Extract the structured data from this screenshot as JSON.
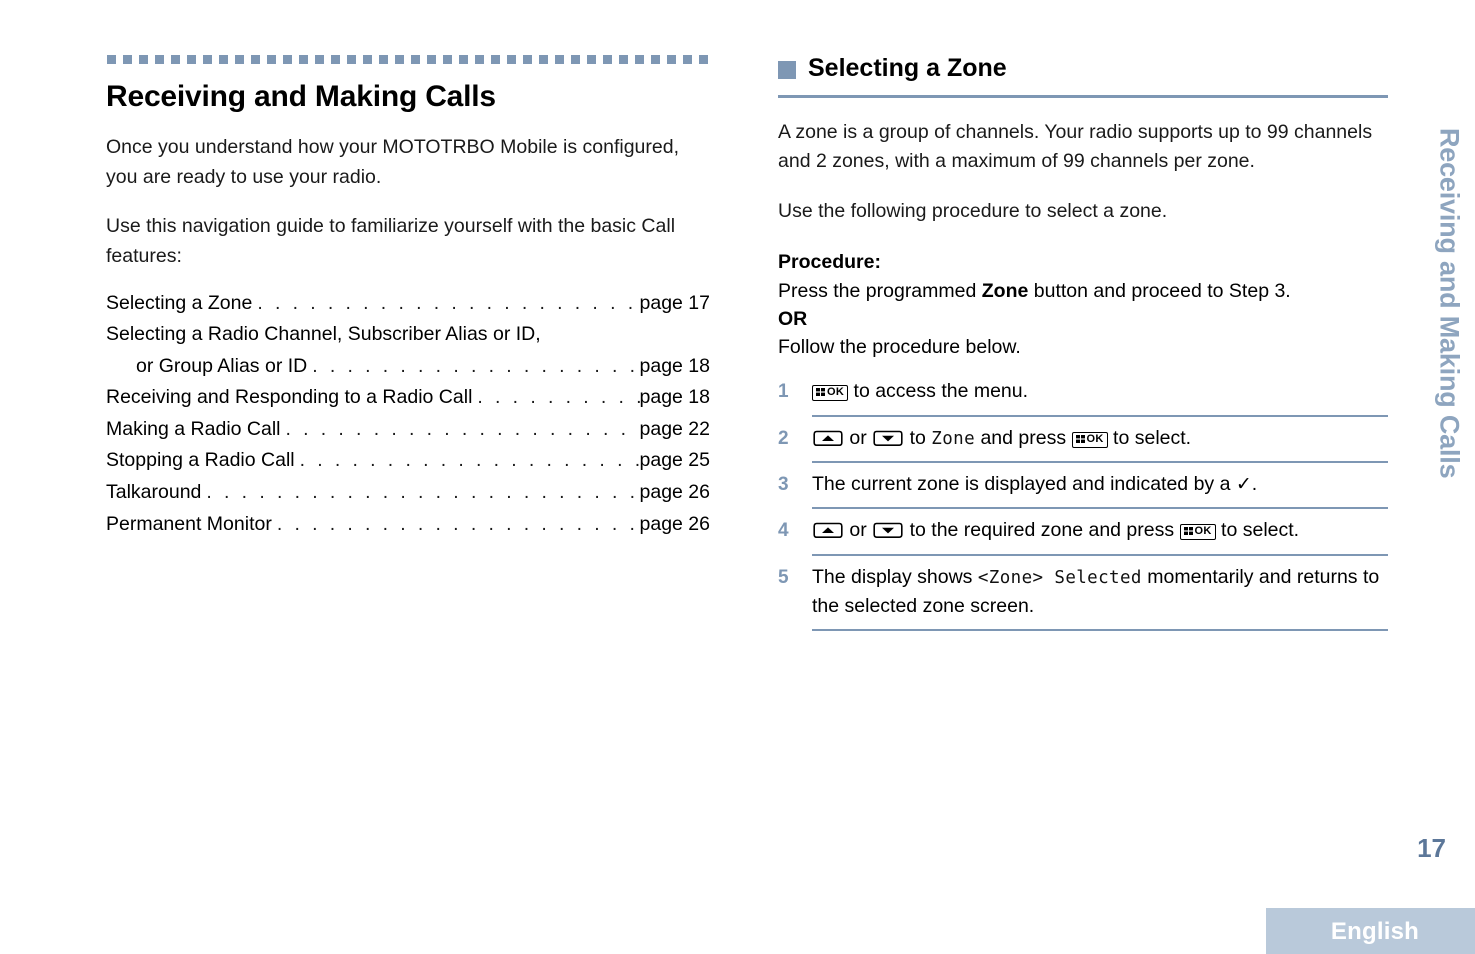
{
  "document": {
    "chapter_title": "Receiving and Making Calls",
    "side_tab": "Receiving and Making Calls",
    "page_number": "17",
    "language": "English",
    "accent_color": "#7e97b4",
    "side_tab_color": "#8ea5bf",
    "page_number_color": "#5c7799",
    "language_band_color": "#b9c9da"
  },
  "left_column": {
    "intro_paragraph": "Once you understand how your MOTOTRBO Mobile is configured, you are ready to use your radio.",
    "guide_paragraph": "Use this navigation guide to familiarize yourself with the basic Call features:",
    "toc": [
      {
        "label": "Selecting a Zone",
        "page": "page 17",
        "indent": false,
        "leader": true
      },
      {
        "label": "Selecting a Radio Channel, Subscriber Alias or ID,",
        "page": "",
        "indent": false,
        "leader": false
      },
      {
        "label": "or Group Alias or ID",
        "page": "page 18",
        "indent": true,
        "leader": true
      },
      {
        "label": "Receiving and Responding to a Radio Call",
        "page": "page 18",
        "indent": false,
        "leader": true
      },
      {
        "label": "Making a Radio Call",
        "page": "page 22",
        "indent": false,
        "leader": true
      },
      {
        "label": "Stopping a Radio Call",
        "page": "page 25",
        "indent": false,
        "leader": true
      },
      {
        "label": "Talkaround",
        "page": "page 26",
        "indent": false,
        "leader": true
      },
      {
        "label": "Permanent Monitor",
        "page": "page 26",
        "indent": false,
        "leader": true
      }
    ]
  },
  "right_column": {
    "section_title": "Selecting a Zone",
    "paragraph_1": "A zone is a group of channels. Your radio supports up to 99 channels and 2 zones, with a maximum of 99 channels per zone.",
    "paragraph_2": "Use the following procedure to select a zone.",
    "procedure_heading": "Procedure:",
    "procedure_intro_1a": "Press the programmed ",
    "procedure_intro_1b": "Zone",
    "procedure_intro_1c": " button and proceed to Step 3.",
    "procedure_or": "OR",
    "procedure_intro_2": "Follow the procedure below.",
    "steps": [
      {
        "num": "1",
        "icon_ok_label": "OK",
        "text_after": " to access the menu."
      },
      {
        "num": "2",
        "text_or": " or ",
        "text_to": " to ",
        "lcd": "Zone",
        "text_and_press": " and press ",
        "icon_ok_label": "OK",
        "text_end": " to select."
      },
      {
        "num": "3",
        "text": "The current zone is displayed and indicated by a ",
        "check": "✓",
        "text_end": "."
      },
      {
        "num": "4",
        "text_or": " or ",
        "text_to": " to the required zone and press ",
        "icon_ok_label": "OK",
        "text_end": " to select."
      },
      {
        "num": "5",
        "text_start": "The display shows ",
        "lcd": "<Zone> Selected",
        "text_end": " momentarily and returns to the selected zone screen."
      }
    ]
  }
}
